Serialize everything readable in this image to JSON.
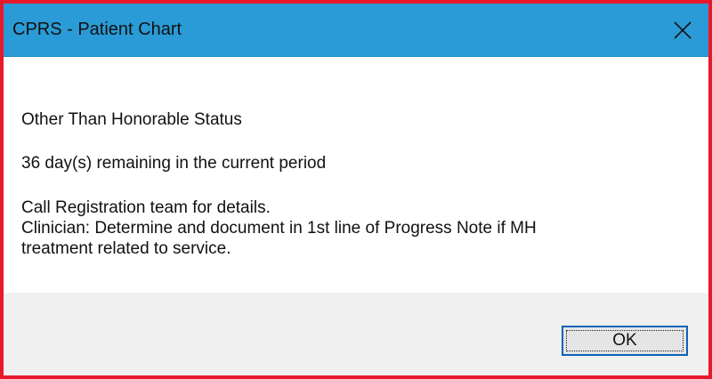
{
  "window": {
    "title": "CPRS - Patient Chart",
    "close_icon": "close-icon"
  },
  "message": {
    "status": "Other Than Honorable Status",
    "remaining": "36 day(s) remaining in the current period",
    "lines": [
      "Call Registration team for details.",
      "Clinician: Determine and document in 1st line of Progress Note if MH",
      "treatment related to service."
    ]
  },
  "buttons": {
    "ok_label": "OK"
  },
  "colors": {
    "titlebar": "#2a9bd6",
    "frame_border": "#e8192c",
    "button_focus": "#0a63b8"
  }
}
